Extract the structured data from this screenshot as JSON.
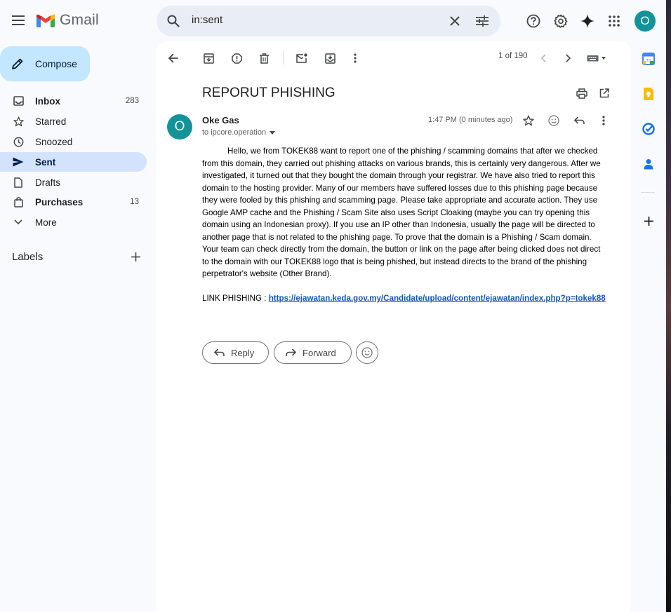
{
  "app": {
    "name": "Gmail",
    "account_initial": "O"
  },
  "search": {
    "value": "in:sent"
  },
  "sidebar": {
    "compose_label": "Compose",
    "items": [
      {
        "label": "Inbox",
        "count": "283"
      },
      {
        "label": "Starred",
        "count": ""
      },
      {
        "label": "Snoozed",
        "count": ""
      },
      {
        "label": "Sent",
        "count": ""
      },
      {
        "label": "Drafts",
        "count": ""
      },
      {
        "label": "Purchases",
        "count": "13"
      },
      {
        "label": "More",
        "count": ""
      }
    ],
    "labels_title": "Labels"
  },
  "toolbar": {
    "page_count": "1 of 190"
  },
  "email": {
    "subject": "REPORUT PHISHING",
    "sender_initial": "O",
    "sender_name": "Oke Gas",
    "recipient": "to ipcore.operation",
    "timestamp": "1:47 PM (0 minutes ago)",
    "body": "Hello, we from TOKEK88 want to report one of the phishing / scamming domains that after we checked from this domain, they carried out phishing attacks on various brands, this is certainly very dangerous. After we investigated, it turned out that they bought the domain through your registrar. We have also tried to report this domain to the hosting provider. Many of our members have suffered losses due to this phishing page because they were fooled by this phishing and scamming page. Please take appropriate and accurate action. They use Google AMP cache and the Phishing / Scam Site also uses Script Cloaking (maybe you can try opening this domain using an Indonesian proxy). If you use an IP other than Indonesia, usually the page will be directed to another page that is not related to the phishing page. To prove that the domain is a Phishing / Scam domain. Your team can check directly from the domain, the button or link on the page after being clicked does not direct to the domain with our TOKEK88 logo that is being phished, but instead directs to the brand of the phishing perpetrator's website (Other Brand).",
    "link_label": "LINK PHISHING : ",
    "link_url": "https://ejawatan.keda.gov.my/Candidate/upload/content/ejawatan/index.php?p=tokek88"
  },
  "actions": {
    "reply_label": "Reply",
    "forward_label": "Forward"
  },
  "colors": {
    "accent": "#0b57d0",
    "compose_bg": "#c2e7ff",
    "active_nav_bg": "#d3e3fd",
    "avatar": "#12939a",
    "link": "#1155cc"
  }
}
